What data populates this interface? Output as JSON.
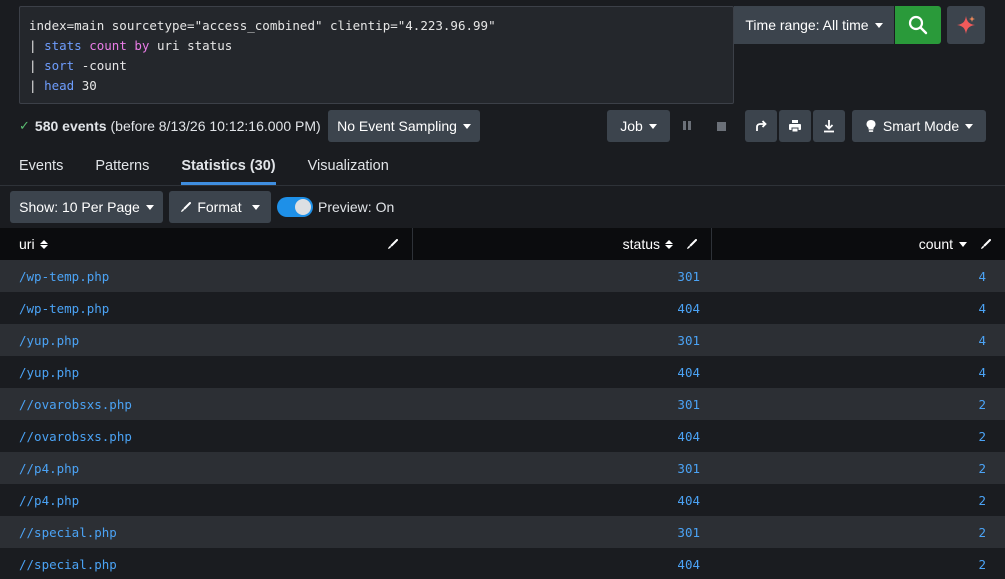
{
  "search": {
    "lines": [
      [
        {
          "t": "index=main sourcetype=\"access_combined\" clientip=\"4.223.96.99\"",
          "c": ""
        }
      ],
      [
        {
          "t": "| ",
          "c": "pipe"
        },
        {
          "t": "stats",
          "c": "kw"
        },
        {
          "t": " ",
          "c": ""
        },
        {
          "t": "count",
          "c": "fn"
        },
        {
          "t": " ",
          "c": ""
        },
        {
          "t": "by",
          "c": "fn"
        },
        {
          "t": " uri status",
          "c": ""
        }
      ],
      [
        {
          "t": "| ",
          "c": "pipe"
        },
        {
          "t": "sort",
          "c": "kw"
        },
        {
          "t": " -count",
          "c": ""
        }
      ],
      [
        {
          "t": "| ",
          "c": "pipe"
        },
        {
          "t": "head",
          "c": "kw"
        },
        {
          "t": " 30",
          "c": ""
        }
      ]
    ]
  },
  "toolbar": {
    "time_range_label": "Time range: All time",
    "search_icon": "search-icon",
    "ai_icon": "sparkle-icon"
  },
  "status": {
    "events_count": "580 events",
    "events_suffix": "(before 8/13/26 10:12:16.000 PM)",
    "sampling_label": "No Event Sampling",
    "job_label": "Job",
    "smart_mode_label": "Smart Mode"
  },
  "tabs": [
    {
      "label": "Events",
      "active": false
    },
    {
      "label": "Patterns",
      "active": false
    },
    {
      "label": "Statistics (30)",
      "active": true
    },
    {
      "label": "Visualization",
      "active": false
    }
  ],
  "controls": {
    "show_label": "Show: 10 Per Page",
    "format_label": "Format",
    "preview_label": "Preview: On",
    "preview_on": true
  },
  "table": {
    "columns": [
      "uri",
      "status",
      "count"
    ],
    "rows": [
      [
        "/wp-temp.php",
        "301",
        "4"
      ],
      [
        "/wp-temp.php",
        "404",
        "4"
      ],
      [
        "/yup.php",
        "301",
        "4"
      ],
      [
        "/yup.php",
        "404",
        "4"
      ],
      [
        "//ovarobsxs.php",
        "301",
        "2"
      ],
      [
        "//ovarobsxs.php",
        "404",
        "2"
      ],
      [
        "//p4.php",
        "301",
        "2"
      ],
      [
        "//p4.php",
        "404",
        "2"
      ],
      [
        "//special.php",
        "301",
        "2"
      ],
      [
        "//special.php",
        "404",
        "2"
      ]
    ]
  },
  "colors": {
    "accent": "#3f8ee0",
    "search_button": "#2a9a3a",
    "link": "#4ba3f5",
    "ai_icon": "#f05a5a"
  }
}
